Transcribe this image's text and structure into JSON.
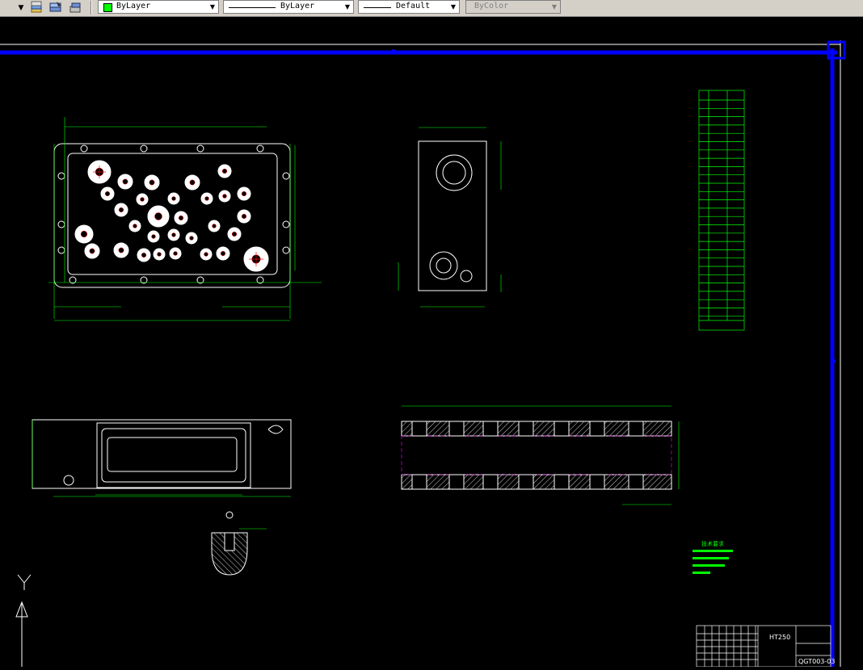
{
  "toolbar": {
    "layer_icons": [
      "layer-manager-icon",
      "layer-state-icon",
      "layer-previous-icon"
    ],
    "color_value": "ByLayer",
    "color_swatch": "#00ff00",
    "linetype_value": "ByLayer",
    "lineweight_value": "Default",
    "plotstyle_value": "ByColor"
  },
  "colors": {
    "background": "#000000",
    "frame": "#0000ff",
    "line": "#00ffff",
    "dim": "#00ff00",
    "hatch": "#ffffff",
    "center": "#ff0000",
    "accent": "#ff00ff"
  },
  "drawing": {
    "scale_note": "技术要求",
    "material": "HT250",
    "drawing_no": "QGT003-03",
    "views": [
      "top-view",
      "side-view",
      "front-view",
      "section-view",
      "detail-view",
      "hole-table",
      "title-block"
    ]
  },
  "ucs": {
    "y_label": "Y"
  }
}
